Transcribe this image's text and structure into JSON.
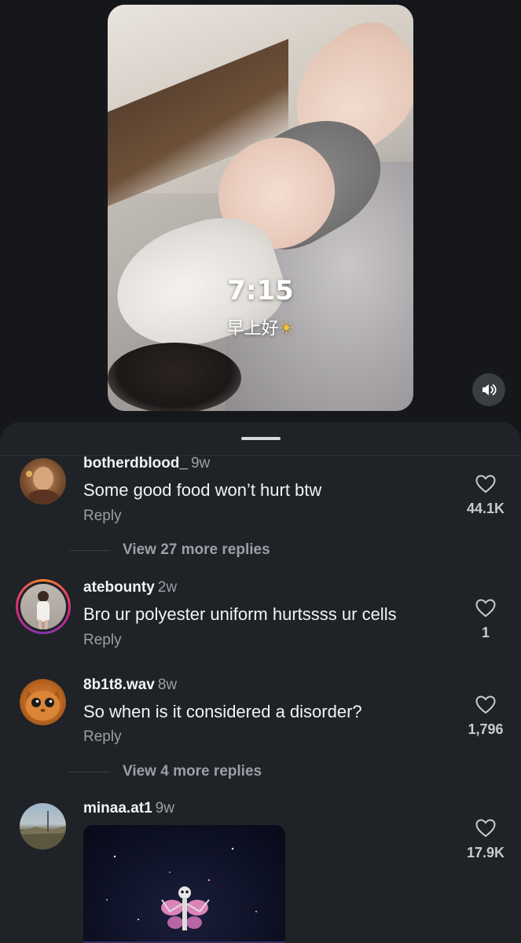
{
  "video": {
    "time_overlay": "7:15",
    "greeting_overlay": "早上好",
    "greeting_emoji": "☀"
  },
  "comments": [
    {
      "username": "botherdblood_",
      "age": "9w",
      "text": "Some good food won’t hurt btw",
      "reply_label": "Reply",
      "like_count": "44.1K",
      "view_more": "View 27 more replies",
      "avatar": "avatar-man-icon"
    },
    {
      "username": "atebounty",
      "age": "2w",
      "text": "Bro ur polyester uniform hurtssss ur cells",
      "reply_label": "Reply",
      "like_count": "1",
      "avatar": "avatar-woman-story-icon"
    },
    {
      "username": "8b1t8.wav",
      "age": "8w",
      "text": "So when is it considered a disorder?",
      "reply_label": "Reply",
      "like_count": "1,796",
      "view_more": "View 4 more replies",
      "avatar": "avatar-cat-icon"
    },
    {
      "username": "minaa.at1",
      "age": "9w",
      "like_count": "17.9K",
      "avatar": "avatar-landscape-icon",
      "attachment": "skeleton-fairy-gif"
    }
  ],
  "colors": {
    "background": "#15171b",
    "sheet": "#1f2226",
    "secondary_text": "#9aa0a6",
    "story_ring_start": "#f58529",
    "story_ring_end": "#dd2a7b"
  }
}
